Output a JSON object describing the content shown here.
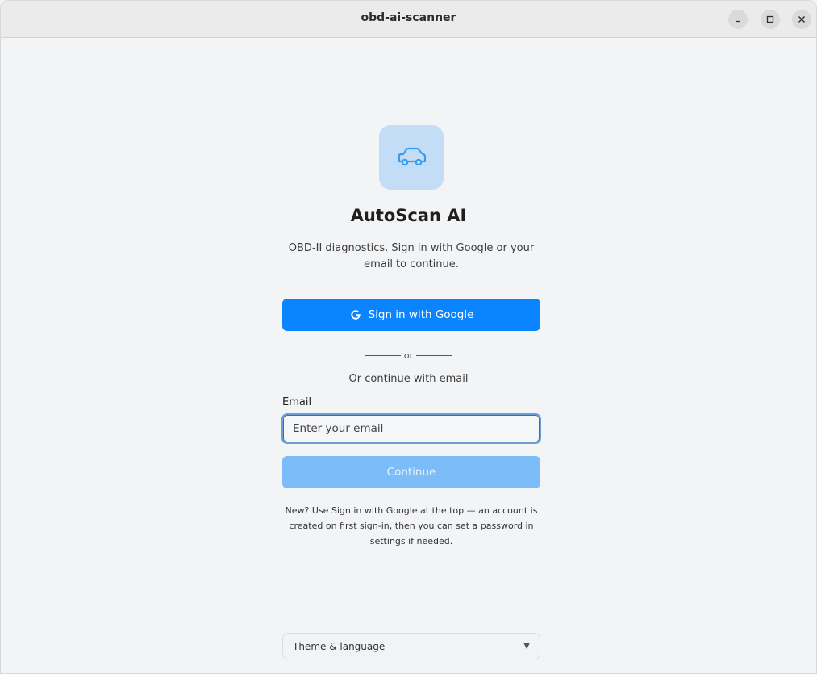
{
  "window": {
    "title": "obd-ai-scanner",
    "controls": {
      "minimize_icon": "minimize-icon",
      "maximize_icon": "maximize-icon",
      "close_icon": "close-icon"
    }
  },
  "app": {
    "logo_icon": "car-icon",
    "name": "AutoScan AI",
    "subtitle": "OBD-II diagnostics. Sign in with Google or your email to continue."
  },
  "auth": {
    "google_button_label": "Sign in with Google",
    "google_icon": "google-icon",
    "divider_text": "or",
    "email_prompt": "Or continue with email",
    "email_label": "Email",
    "email_placeholder": "Enter your email",
    "email_value": "",
    "continue_label": "Continue",
    "hint": "New? Use Sign in with Google at the top — an account is created on first sign-in, then you can set a password in settings if needed."
  },
  "footer": {
    "theme_select_label": "Theme & language",
    "theme_select_arrow": "▼"
  },
  "colors": {
    "accent": "#0a84ff",
    "accent_disabled": "#7cbcf8",
    "logo_bg": "#c3ddf6",
    "logo_icon": "#3a9cf0",
    "background": "#f3f4f6"
  }
}
